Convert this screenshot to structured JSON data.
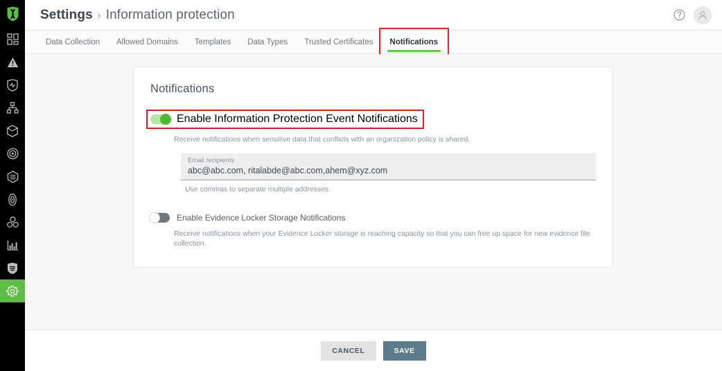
{
  "brand": {
    "logo_icon": "shield-logo",
    "accent_green": "#5cbf44",
    "annotation_red": "#ee1c1c"
  },
  "sidebar": {
    "items": [
      {
        "name": "dashboard",
        "icon": "dashboard-icon",
        "active": false
      },
      {
        "name": "alerts",
        "icon": "warning-triangle-icon",
        "active": false
      },
      {
        "name": "threat-health",
        "icon": "shield-pulse-icon",
        "active": false
      },
      {
        "name": "topology",
        "icon": "network-nodes-icon",
        "active": false
      },
      {
        "name": "data-store",
        "icon": "database-icon",
        "active": false
      },
      {
        "name": "targets",
        "icon": "target-icon",
        "active": false
      },
      {
        "name": "policies",
        "icon": "hexagon-layers-icon",
        "active": false
      },
      {
        "name": "identity",
        "icon": "fingerprint-icon",
        "active": false
      },
      {
        "name": "integrations",
        "icon": "cluster-icon",
        "active": false
      },
      {
        "name": "reports",
        "icon": "bar-chart-icon",
        "active": false
      },
      {
        "name": "protection",
        "icon": "shield-lines-icon",
        "active": false
      },
      {
        "name": "settings",
        "icon": "gear-icon",
        "active": true
      }
    ]
  },
  "header": {
    "breadcrumb_root": "Settings",
    "breadcrumb_separator": "›",
    "breadcrumb_leaf": "Information protection",
    "help_icon": "question-circle-icon",
    "avatar_icon": "user-avatar-icon"
  },
  "tabs": [
    {
      "label": "Data Collection",
      "active": false,
      "annotated": false
    },
    {
      "label": "Allowed Domains",
      "active": false,
      "annotated": false
    },
    {
      "label": "Templates",
      "active": false,
      "annotated": false
    },
    {
      "label": "Data Types",
      "active": false,
      "annotated": false
    },
    {
      "label": "Trusted Certificates",
      "active": false,
      "annotated": false
    },
    {
      "label": "Notifications",
      "active": true,
      "annotated": true
    }
  ],
  "card": {
    "title": "Notifications",
    "event_notifications": {
      "toggle_state": "on",
      "label": "Enable Information Protection Event Notifications",
      "annotated": true,
      "description": "Receive notifications when sensitive data that conflicts with an organization policy is shared.",
      "email_field": {
        "label": "Email recipients",
        "value": "abc@abc.com, ritalabde@abc.com,ahem@xyz.com",
        "placeholder": "Email recipients",
        "hint": "Use commas to separate multiple addresses"
      }
    },
    "evidence_locker": {
      "toggle_state": "off",
      "label": "Enable Evidence Locker Storage Notifications",
      "description": "Receive notifications when your Evidence Locker storage is reaching capacity so that you can free up space for new evidence file collection."
    }
  },
  "footer": {
    "cancel_label": "CANCEL",
    "save_label": "SAVE"
  }
}
